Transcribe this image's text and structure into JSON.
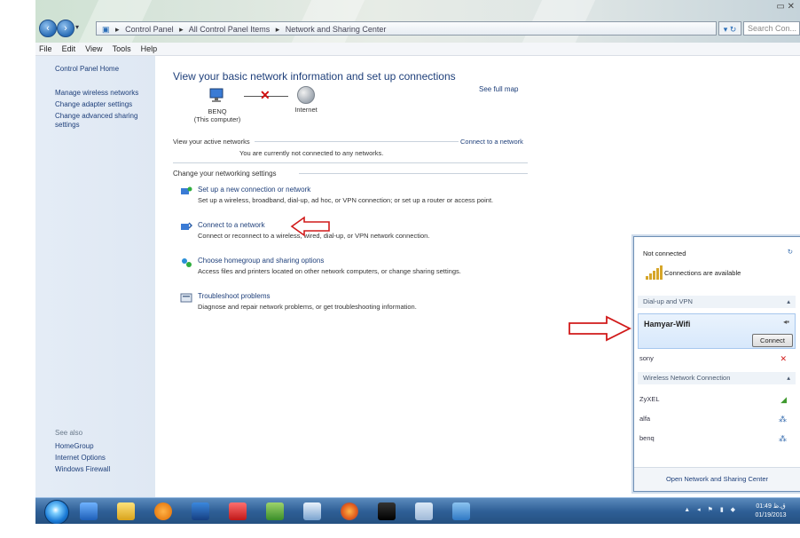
{
  "window": {
    "breadcrumb": [
      "Control Panel",
      "All Control Panel Items",
      "Network and Sharing Center"
    ],
    "search_placeholder": "Search Con...",
    "menu": [
      "File",
      "Edit",
      "View",
      "Tools",
      "Help"
    ]
  },
  "left_pane": {
    "home": "Control Panel Home",
    "links": [
      "Manage wireless networks",
      "Change adapter settings",
      "Change advanced sharing settings"
    ],
    "see_also_title": "See also",
    "see_also": [
      "HomeGroup",
      "Internet Options",
      "Windows Firewall"
    ]
  },
  "main": {
    "heading": "View your basic network information and set up connections",
    "see_full_map": "See full map",
    "computer_name": "BENQ",
    "computer_sub": "(This computer)",
    "internet_label": "Internet",
    "active_networks_label": "View your active networks",
    "connect_link": "Connect to a network",
    "not_connected_msg": "You are currently not connected to any networks.",
    "change_settings_title": "Change your networking settings",
    "tasks": [
      {
        "link": "Set up a new connection or network",
        "desc": "Set up a wireless, broadband, dial-up, ad hoc, or VPN connection; or set up a router or access point."
      },
      {
        "link": "Connect to a network",
        "desc": "Connect or reconnect to a wireless, wired, dial-up, or VPN network connection."
      },
      {
        "link": "Choose homegroup and sharing options",
        "desc": "Access files and printers located on other network computers, or change sharing settings."
      },
      {
        "link": "Troubleshoot problems",
        "desc": "Diagnose and repair network problems, or get troubleshooting information."
      }
    ]
  },
  "popup": {
    "status": "Not connected",
    "available": "Connections are available",
    "dialup_group": "Dial-up and VPN",
    "selected_network": "Hamyar-Wifi",
    "connect_button": "Connect",
    "dialup_item": "sony",
    "wireless_group": "Wireless Network Connection",
    "networks": [
      "ZyXEL",
      "alfa",
      "benq"
    ],
    "footer": "Open Network and Sharing Center"
  },
  "taskbar": {
    "clock_time": "01:49 ق.ظ",
    "clock_date": "01/19/2013"
  },
  "colors": {
    "link": "#1e3f7a",
    "arrow": "#d11a1a",
    "taskbar": "#2e5f96"
  }
}
